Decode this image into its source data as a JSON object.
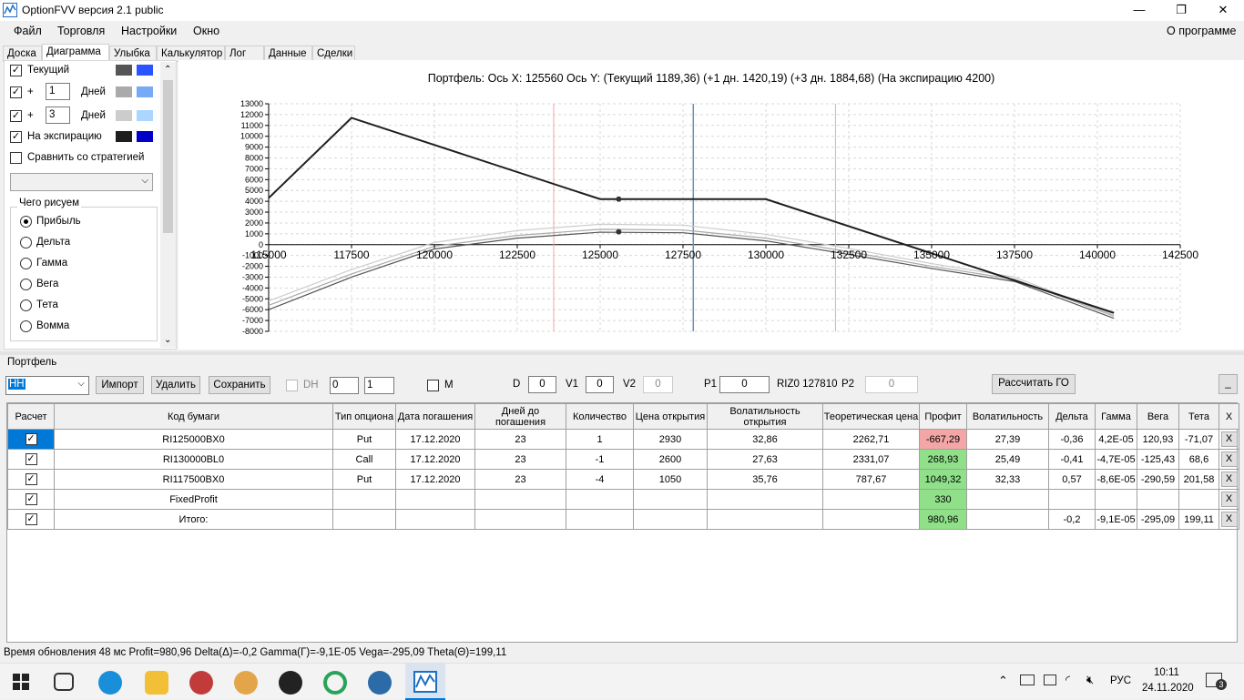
{
  "window": {
    "title": "OptionFVV версия 2.1 public",
    "minimize": "—",
    "maximize": "❐",
    "close": "✕"
  },
  "menu": {
    "items": [
      "Файл",
      "Торговля",
      "Настройки",
      "Окно"
    ],
    "about": "О программе"
  },
  "tabs": [
    "Доска",
    "Диаграмма",
    "Улыбка",
    "Калькулятор",
    "Лог",
    "Данные",
    "Сделки"
  ],
  "left": {
    "current_label": "Текущий",
    "plus": "+",
    "days_label": "Дней",
    "day1": "1",
    "day3": "3",
    "expiry_label": "На экспирацию",
    "compare_label": "Сравнить со стратегией",
    "draw_group": "Чего рисуем",
    "radios": [
      "Прибыль",
      "Дельта",
      "Гамма",
      "Вега",
      "Тета",
      "Вомма"
    ],
    "swatches": {
      "current": [
        "#555555",
        "#2a54ff"
      ],
      "plus1": [
        "#aaaaaa",
        "#77aaf5"
      ],
      "plus3": [
        "#cccccc",
        "#aad6ff"
      ],
      "expiry": [
        "#1e1e1e",
        "#0000c8"
      ]
    }
  },
  "chart_header": "Портфель: Ось X: 125560 Ось Y:  (Текущий 1189,36)  (+1 дн. 1420,19)  (+3 дн. 1884,68)  (На экспирацию 4200)",
  "chart_data": {
    "type": "line",
    "xlim": [
      115000,
      142500
    ],
    "ylim": [
      -8000,
      13000
    ],
    "x_ticks": [
      "115000",
      "117500",
      "120000",
      "122500",
      "125000",
      "127500",
      "130000",
      "132500",
      "135000",
      "137500",
      "140000",
      "142500"
    ],
    "y_ticks": [
      "13000",
      "12000",
      "11000",
      "10000",
      "9000",
      "8000",
      "7000",
      "6000",
      "5000",
      "4000",
      "3000",
      "2000",
      "1000",
      "0",
      "-1000",
      "-2000",
      "-3000",
      "-4000",
      "-5000",
      "-6000",
      "-7000",
      "-8000"
    ],
    "vlines": {
      "red": [
        123600,
        132100
      ],
      "blue": [
        127810
      ]
    },
    "series": [
      {
        "points": [
          [
            115000,
            4300
          ],
          [
            117500,
            11700
          ],
          [
            125000,
            4200
          ],
          [
            130000,
            4200
          ],
          [
            140500,
            -6300
          ]
        ],
        "color": "#1e1e1e"
      },
      {
        "points": [
          [
            115000,
            -6000
          ],
          [
            117500,
            -3000
          ],
          [
            120000,
            -400
          ],
          [
            122500,
            600
          ],
          [
            125000,
            1150
          ],
          [
            127500,
            1100
          ],
          [
            130000,
            350
          ],
          [
            132500,
            -900
          ],
          [
            135000,
            -2200
          ],
          [
            137500,
            -3400
          ],
          [
            140500,
            -6800
          ]
        ],
        "color": "#555555"
      },
      {
        "points": [
          [
            115000,
            -5600
          ],
          [
            117500,
            -2700
          ],
          [
            120000,
            -150
          ],
          [
            122500,
            850
          ],
          [
            125000,
            1420
          ],
          [
            127500,
            1350
          ],
          [
            130000,
            600
          ],
          [
            132500,
            -650
          ],
          [
            135000,
            -2000
          ],
          [
            137500,
            -3200
          ],
          [
            140500,
            -6600
          ]
        ],
        "color": "#aaaaaa"
      },
      {
        "points": [
          [
            115000,
            -5200
          ],
          [
            117500,
            -2300
          ],
          [
            120000,
            200
          ],
          [
            122500,
            1300
          ],
          [
            125000,
            1880
          ],
          [
            127500,
            1800
          ],
          [
            130000,
            950
          ],
          [
            132500,
            -350
          ],
          [
            135000,
            -1750
          ],
          [
            137500,
            -3000
          ],
          [
            140500,
            -6500
          ]
        ],
        "color": "#cccccc"
      }
    ],
    "markers": [
      [
        125560,
        4200
      ],
      [
        125560,
        1189
      ]
    ]
  },
  "portfolio": {
    "group_label": "Портфель",
    "select_value": "НН",
    "import": "Импорт",
    "delete": "Удалить",
    "save": "Сохранить",
    "dh": "DH",
    "dh_v1": "0",
    "dh_v2": "1",
    "m": "M",
    "d_label": "D",
    "d_value": "0",
    "v1_label": "V1",
    "v1_value": "0",
    "v2_label": "V2",
    "v2_value": "0",
    "p1_label": "P1",
    "p1_value": "0",
    "riz": "RIZ0 127810",
    "p2_label": "P2",
    "p2_value": "0",
    "calc_go": "Рассчитать ГО",
    "minimize": "_"
  },
  "table": {
    "headers": [
      "Расчет",
      "Код бумаги",
      "Тип опциона",
      "Дата погашения",
      "Дней до погашения",
      "Количество",
      "Цена открытия",
      "Волатильность открытия",
      "Теоретическая цена",
      "Профит",
      "Волатильность",
      "Дельта",
      "Гамма",
      "Вега",
      "Тета",
      "X"
    ],
    "rows": [
      [
        "RI125000BX0",
        "Put",
        "17.12.2020",
        "23",
        "1",
        "2930",
        "32,86",
        "2262,71",
        "-667,29",
        "27,39",
        "-0,36",
        "4,2E-05",
        "120,93",
        "-71,07"
      ],
      [
        "RI130000BL0",
        "Call",
        "17.12.2020",
        "23",
        "-1",
        "2600",
        "27,63",
        "2331,07",
        "268,93",
        "25,49",
        "-0,41",
        "-4,7E-05",
        "-125,43",
        "68,6"
      ],
      [
        "RI117500BX0",
        "Put",
        "17.12.2020",
        "23",
        "-4",
        "1050",
        "35,76",
        "787,67",
        "1049,32",
        "32,33",
        "0,57",
        "-8,6E-05",
        "-290,59",
        "201,58"
      ],
      [
        "FixedProfit",
        "",
        "",
        "",
        "",
        "",
        "",
        "",
        "330",
        "",
        "",
        "",
        "",
        ""
      ],
      [
        "Итого:",
        "",
        "",
        "",
        "",
        "",
        "",
        "",
        "980,96",
        "",
        "-0,2",
        "-9,1E-05",
        "-295,09",
        "199,11"
      ]
    ],
    "profit_colors": [
      "#f4a6a6",
      "#90e08a",
      "#90e08a",
      "#90e08a",
      "#90e08a"
    ],
    "x": "X"
  },
  "status": "Время обновления 48 мс  Profit=980,96 Delta(Δ)=-0,2 Gamma(Γ)=-9,1E-05 Vega=-295,09 Theta(Θ)=199,11",
  "taskbar": {
    "lang": "РУС",
    "time": "10:11",
    "date": "24.11.2020",
    "notif": "3"
  }
}
